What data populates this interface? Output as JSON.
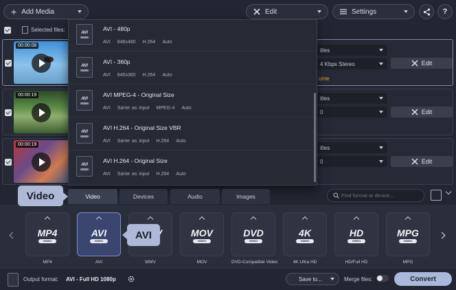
{
  "toolbar": {
    "add_media_label": "Add Media",
    "edit_label": "Edit",
    "settings_label": "Settings",
    "help_label": "?"
  },
  "selection": {
    "label": "Selected files:"
  },
  "files": [
    {
      "duration": "00:00:08",
      "subtitles": "itles",
      "audio": "4 Kbps Stereo",
      "note": "ume",
      "edit_label": "Edit",
      "thumb": "sky-bird"
    },
    {
      "duration": "00:00:19",
      "subtitles": "itles",
      "audio": "0",
      "note": "",
      "edit_label": "Edit",
      "thumb": "forest"
    },
    {
      "duration": "00:00:19",
      "subtitles": "itles",
      "audio": "0",
      "note": "",
      "edit_label": "Edit",
      "thumb": "crowd"
    }
  ],
  "presets": [
    {
      "title": "AVI - 480p",
      "specs": [
        "AVI",
        "848x480",
        "H.264",
        "Auto"
      ],
      "icon": "AVI"
    },
    {
      "title": "AVI - 360p",
      "specs": [
        "AVI",
        "640x360",
        "H.264",
        "Auto"
      ],
      "icon": "AVI"
    },
    {
      "title": "AVI MPEG-4 - Original Size",
      "specs": [
        "AVI",
        "Same as input",
        "MPEG-4",
        "Auto"
      ],
      "icon": "AVI"
    },
    {
      "title": "AVI H.264 - Original Size VBR",
      "specs": [
        "AVI",
        "Same as input",
        "H.264",
        "Auto"
      ],
      "icon": "AVI"
    },
    {
      "title": "AVI H.264 - Original Size",
      "specs": [
        "AVI",
        "Same as input",
        "H.264",
        "Auto"
      ],
      "icon": "AVI"
    }
  ],
  "callouts": {
    "video": "Video",
    "avi": "AVI"
  },
  "tabs": [
    "Video",
    "Devices",
    "Audio",
    "Images"
  ],
  "active_tab": "Video",
  "search": {
    "placeholder": "Find format or device..."
  },
  "formats": [
    {
      "logo": "MP4",
      "label": "MP4"
    },
    {
      "logo": "AVI",
      "label": "AVI"
    },
    {
      "logo": "WMV",
      "label": "WMV"
    },
    {
      "logo": "MOV",
      "label": "MOV"
    },
    {
      "logo": "DVD",
      "label": "DVD-Compatible Video"
    },
    {
      "logo": "4K",
      "label": "4K Ultra HD"
    },
    {
      "logo": "HD",
      "label": "HD/Full HD"
    },
    {
      "logo": "MPG",
      "label": "MPG"
    }
  ],
  "active_format": "AVI",
  "bottom": {
    "output_format_label": "Output format:",
    "output_format_value": "AVI - Full HD 1080p",
    "save_to_label": "Save to...",
    "merge_label": "Merge files:",
    "convert_label": "Convert"
  },
  "colors": {
    "convert": "#aab8dc",
    "accent": "#f0a030",
    "active_format": "#3a4670"
  }
}
